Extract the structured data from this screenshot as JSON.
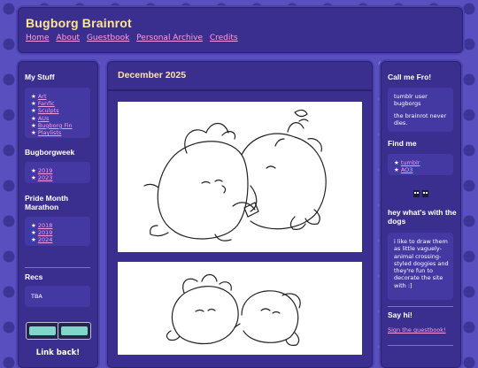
{
  "header": {
    "site_title": "Bugborg Brainrot",
    "nav": [
      "Home",
      "About",
      "Guestbook",
      "Personal Archive",
      "Credits"
    ]
  },
  "left": {
    "my_stuff_title": "My Stuff",
    "my_stuff_items": [
      "Art",
      "Fanfic",
      "Sculpts",
      "AUs",
      "Bugborg Fin",
      "Playlists"
    ],
    "bugborgweek_title": "Bugborgweek",
    "bugborgweek_items": [
      "2019",
      "2023"
    ],
    "pride_title": "Pride Month Marathon",
    "pride_items": [
      "2018",
      "2019",
      "2024"
    ],
    "recs_title": "Recs",
    "recs_text": "TBA",
    "link_back": "Link back!"
  },
  "main": {
    "post_title": "December 2025"
  },
  "right": {
    "call_me_title": "Call me Fro!",
    "call_me_text_1": "tumblr user bugborgs",
    "call_me_text_2": "the brainrot never dies.",
    "find_me_title": "Find me",
    "find_me_items": [
      "tumblr",
      "AO3"
    ],
    "dogs_title": "hey what's with the dogs",
    "dogs_text": "i like to draw them as little vaguely-animal crossing-styled doggies and they're fun to decorate the site with :]",
    "say_hi_title": "Say hi!",
    "guestbook_link": "Sign the guestbook!"
  },
  "colors": {
    "background": "#5a4fbf",
    "panel": "#3a2f8f",
    "title_yellow": "#ffe59a",
    "link_pink": "#ff9ee3"
  }
}
